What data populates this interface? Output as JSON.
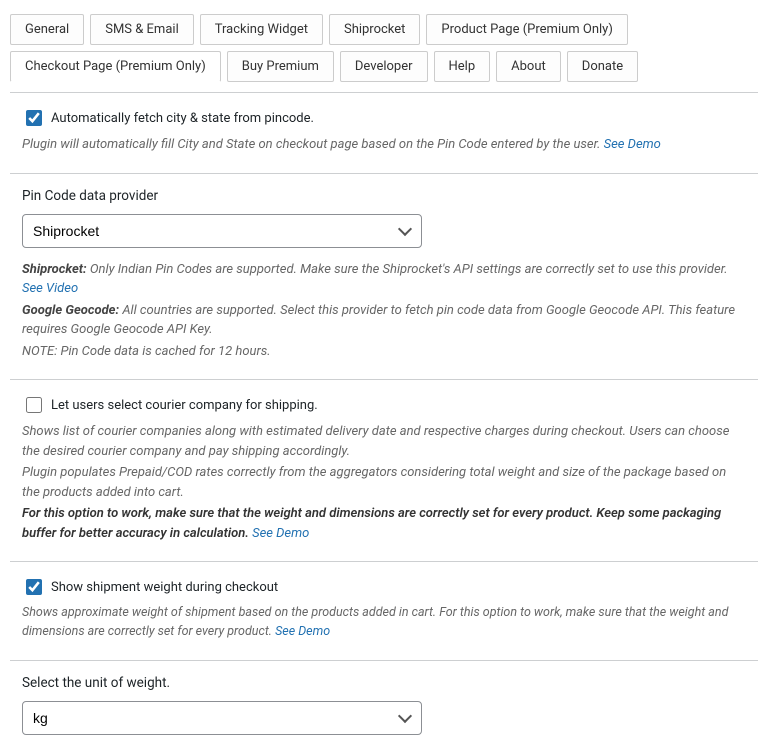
{
  "tabs": {
    "general": "General",
    "sms": "SMS & Email",
    "tracking": "Tracking Widget",
    "shiprocket": "Shiprocket",
    "product": "Product Page (Premium Only)",
    "checkout": "Checkout Page (Premium Only)",
    "buy": "Buy Premium",
    "developer": "Developer",
    "help": "Help",
    "about": "About",
    "donate": "Donate"
  },
  "auto_fetch": {
    "label": "Automatically fetch city & state from pincode.",
    "desc": "Plugin will automatically fill City and State on checkout page based on the Pin Code entered by the user.",
    "demo": "See Demo"
  },
  "provider": {
    "title": "Pin Code data provider",
    "value": "Shiprocket",
    "shiprocket_label": "Shiprocket:",
    "shiprocket_desc": " Only Indian Pin Codes are supported. Make sure the Shiprocket's API settings are correctly set to use this provider. ",
    "see_video": "See Video",
    "google_label": "Google Geocode:",
    "google_desc": " All countries are supported. Select this provider to fetch pin code data from Google Geocode API. This feature requires Google Geocode API Key.",
    "note": "NOTE: Pin Code data is cached for 12 hours."
  },
  "courier": {
    "label": "Let users select courier company for shipping.",
    "desc1": "Shows list of courier companies along with estimated delivery date and respective charges during checkout. Users can choose the desired courier company and pay shipping accordingly.",
    "desc2": "Plugin populates Prepaid/COD rates correctly from the aggregators considering total weight and size of the package based on the products added into cart.",
    "desc3": "For this option to work, make sure that the weight and dimensions are correctly set for every product. Keep some packaging buffer for better accuracy in calculation.",
    "demo": "See Demo"
  },
  "weight": {
    "label": "Show shipment weight during checkout",
    "desc": "Shows approximate weight of shipment based on the products added in cart. For this option to work, make sure that the weight and dimensions are correctly set for every product.",
    "demo": "See Demo"
  },
  "unit": {
    "title": "Select the unit of weight.",
    "value": "kg"
  }
}
